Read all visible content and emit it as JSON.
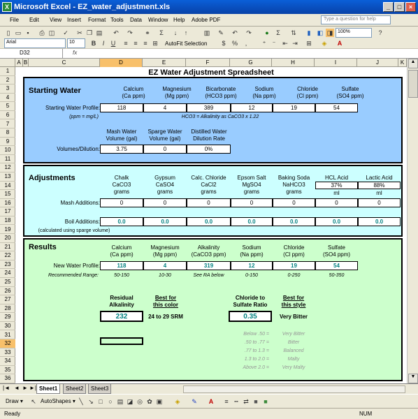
{
  "window": {
    "title": "Microsoft Excel - EZ_water_adjustment.xls"
  },
  "menu": {
    "items": [
      "File",
      "Edit",
      "View",
      "Insert",
      "Format",
      "Tools",
      "Data",
      "Window",
      "Help",
      "Adobe PDF"
    ],
    "help_placeholder": "Type a question for help"
  },
  "toolbar": {
    "zoom": "100%",
    "font": "Arial",
    "font_size": "10",
    "autofit": "AutoFit Selection"
  },
  "formula": {
    "cell": "D32",
    "fx": "fx"
  },
  "columns": [
    "A",
    "B",
    "C",
    "D",
    "E",
    "F",
    "G",
    "H",
    "I",
    "J",
    "K"
  ],
  "rows": [
    "1",
    "2",
    "3",
    "4",
    "5",
    "6",
    "7",
    "8",
    "9",
    "10",
    "11",
    "12",
    "13",
    "14",
    "15",
    "16",
    "17",
    "18",
    "19",
    "20",
    "21",
    "22",
    "23",
    "24",
    "25",
    "26",
    "27",
    "28",
    "29",
    "30",
    "31",
    "32",
    "33",
    "34",
    "35",
    "36"
  ],
  "sheet": {
    "title": "EZ Water Adjustment Spreadsheet",
    "starting": {
      "heading": "Starting Water",
      "cols": [
        [
          "Calcium",
          "(Ca ppm)"
        ],
        [
          "Magnesium",
          "(Mg ppm)"
        ],
        [
          "Bicarbonate",
          "(HCO3 ppm)"
        ],
        [
          "Sodium",
          "(Na ppm)"
        ],
        [
          "Chloride",
          "(Cl ppm)"
        ],
        [
          "Sulfate",
          "(SO4 ppm)"
        ]
      ],
      "profile_label": "Starting Water Profile:",
      "values": [
        "118",
        "4",
        "389",
        "12",
        "19",
        "54"
      ],
      "units_note": "(ppm = mg/L)",
      "hco3_note": "HCO3 = Alkalinity as CaCO3 x 1.22",
      "vol_cols": [
        [
          "Mash Water",
          "Volume (gal)"
        ],
        [
          "Sparge Water",
          "Volume (gal)"
        ],
        [
          "Distilled Water",
          "Dilution Rate"
        ]
      ],
      "vol_label": "Volumes/Dilution:",
      "vol_values": [
        "3.75",
        "0",
        "0%"
      ]
    },
    "adjust": {
      "heading": "Adjustments",
      "cols": [
        [
          "Chalk",
          "CaCO3",
          "grams"
        ],
        [
          "Gypsum",
          "CaSO4",
          "grams"
        ],
        [
          "Calc. Chloride",
          "CaCl2",
          "grams"
        ],
        [
          "Epsom Salt",
          "MgSO4",
          "grams"
        ],
        [
          "Baking Soda",
          "NaHCO3",
          "grams"
        ],
        [
          "HCL Acid",
          "37%",
          "ml"
        ],
        [
          "Lactic Acid",
          "88%",
          "ml"
        ]
      ],
      "mash_label": "Mash Additions:",
      "mash_values": [
        "0",
        "0",
        "0",
        "0",
        "0",
        "0",
        "0"
      ],
      "boil_label": "Boil Additions:",
      "boil_values": [
        "0.0",
        "0.0",
        "0.0",
        "0.0",
        "0.0",
        "0.0",
        "0.0"
      ],
      "boil_note": "(calculated using sparge volume)"
    },
    "results": {
      "heading": "Results",
      "cols": [
        [
          "Calcium",
          "(Ca ppm)"
        ],
        [
          "Magnesium",
          "(Mg ppm)"
        ],
        [
          "Alkalinity",
          "(CaCO3 ppm)"
        ],
        [
          "Sodium",
          "(Na ppm)"
        ],
        [
          "Chloride",
          "(Cl ppm)"
        ],
        [
          "Sulfate",
          "(SO4 ppm)"
        ]
      ],
      "profile_label": "New Water Profile:",
      "values": [
        "118",
        "4",
        "319",
        "12",
        "19",
        "54"
      ],
      "range_label": "Recommended Range:",
      "ranges": [
        "50-150",
        "10-30",
        "See RA below",
        "0-150",
        "0-250",
        "50-350"
      ],
      "ra_label": [
        "Residual",
        "Alkalinity"
      ],
      "ra_value": "232",
      "color_label": [
        "Best for",
        "this color"
      ],
      "color_value": "24 to 29 SRM",
      "ratio_label": [
        "Chloride to",
        "Sulfate Ratio"
      ],
      "ratio_value": "0.35",
      "style_label": [
        "Best for",
        "this style"
      ],
      "style_value": "Very Bitter",
      "ratio_table": [
        [
          "Below .50 =",
          "Very Bitter"
        ],
        [
          ".50 to .77 =",
          "Bitter"
        ],
        [
          ".77 to 1.3 =",
          "Balanced"
        ],
        [
          "1.3 to 2.0 =",
          "Malty"
        ],
        [
          "Above 2.0 =",
          "Very Malty"
        ]
      ]
    }
  },
  "tabs": [
    "Sheet1",
    "Sheet2",
    "Sheet3"
  ],
  "drawbar": {
    "draw": "Draw ▾",
    "autoshapes": "AutoShapes ▾"
  },
  "status": {
    "left": "Ready",
    "right": "NUM"
  }
}
